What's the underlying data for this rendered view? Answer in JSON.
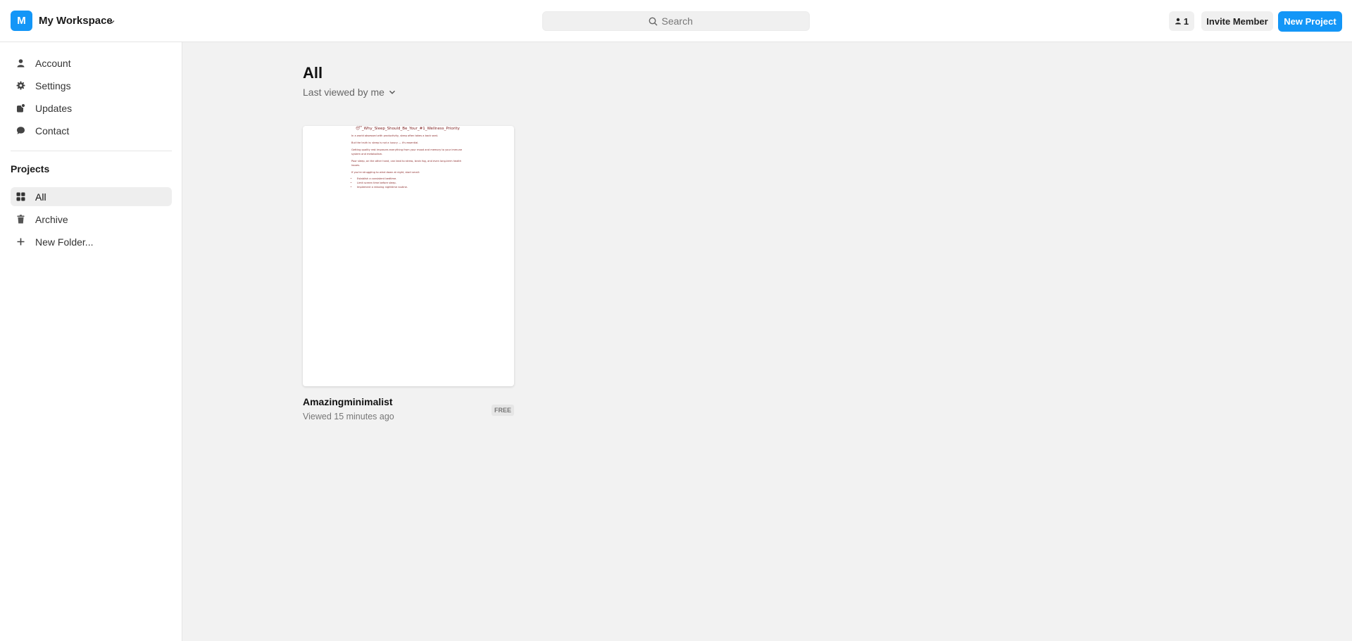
{
  "header": {
    "workspace_initial": "M",
    "workspace_name": "My Workspace",
    "search_placeholder": "Search",
    "members_count": "1",
    "invite_label": "Invite Member",
    "new_project_label": "New Project"
  },
  "sidebar": {
    "items": [
      {
        "label": "Account",
        "icon": "user-icon"
      },
      {
        "label": "Settings",
        "icon": "gear-icon"
      },
      {
        "label": "Updates",
        "icon": "updates-icon"
      },
      {
        "label": "Contact",
        "icon": "chat-bubble-icon"
      }
    ],
    "section_title": "Projects",
    "projects": [
      {
        "label": "All",
        "icon": "grid-icon",
        "active": true
      },
      {
        "label": "Archive",
        "icon": "trash-icon"
      },
      {
        "label": "New Folder...",
        "icon": "plus-icon"
      }
    ]
  },
  "main": {
    "title": "All",
    "sort_label": "Last viewed by me",
    "projects": [
      {
        "name": "Amazingminimalist",
        "viewed": "Viewed 15 minutes ago",
        "badge": "FREE",
        "preview": {
          "title": "😴_Why_Sleep_Should_Be_Your_#1_Wellness_Priority",
          "p1": "In a world obsessed with productivity, sleep often takes a back seat.",
          "p2": "But the truth is: sleep is not a luxury — it's essential.",
          "p3": "Getting quality rest improves everything from your mood and memory to your immune system and metabolism.",
          "p4": "Poor sleep, on the other hand, can lead to stress, brain fog, and even long-term health issues.",
          "p5": "If you're struggling to wind down at night, start small:",
          "bullets": [
            "Establish a consistent bedtime.",
            "Limit screen time before sleep.",
            "Implement a relaxing nighttime routine."
          ]
        }
      }
    ]
  }
}
